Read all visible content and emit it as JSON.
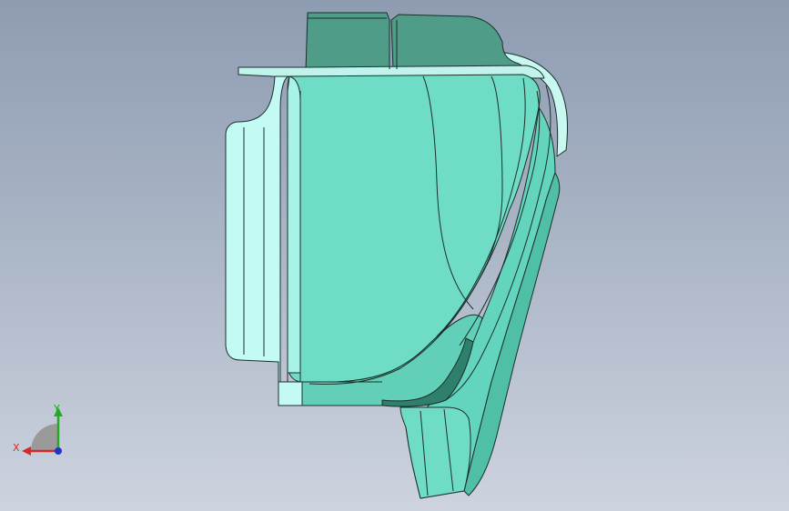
{
  "viewport": {
    "background_top": "#8e9cb2",
    "background_bottom": "#cdd3df"
  },
  "model": {
    "face_color": "#6fdcc5",
    "flange_color": "#b8f5ee",
    "shadow_color": "#4e9e8a",
    "edge_color": "#1b2f2a"
  },
  "triad": {
    "x_label": "X",
    "y_label": "Y",
    "x_color": "#d42a2a",
    "y_color": "#22aa22",
    "z_color": "#2233cc"
  }
}
